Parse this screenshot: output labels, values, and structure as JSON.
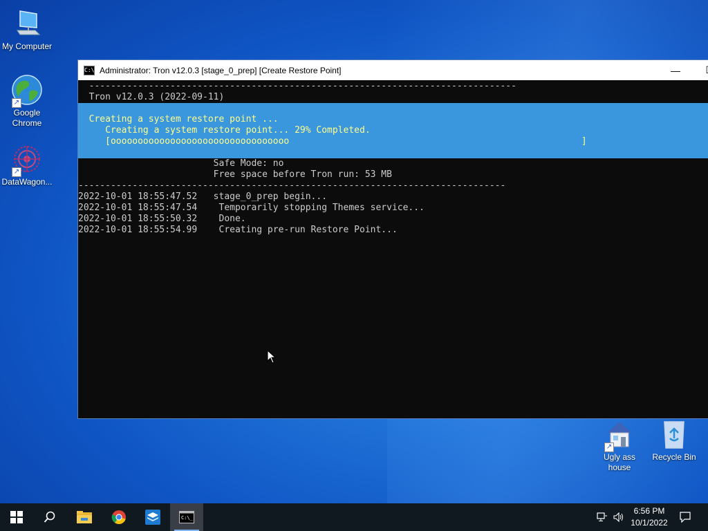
{
  "desktop": {
    "icons": [
      {
        "label": "My Computer",
        "icon": "computer-icon"
      },
      {
        "label": "Google Chrome",
        "icon": "chrome-globe-icon"
      },
      {
        "label": "DataWagon...",
        "icon": "datawagon-icon"
      },
      {
        "label": "Ugly ass house",
        "icon": "house-icon"
      },
      {
        "label": "Recycle Bin",
        "icon": "recycle-bin-icon"
      }
    ]
  },
  "window": {
    "title": "Administrator:  Tron v12.0.3 [stage_0_prep] [Create Restore Point]",
    "minimize_glyph": "—",
    "maximize_glyph": "☐"
  },
  "console": {
    "top_lines": [
      "  -------------------------------------------------------------------------------",
      "  Tron v12.0.3 (2022-09-11)"
    ],
    "progress_lines": [
      "  Creating a system restore point ...",
      "     Creating a system restore point... 29% Completed.",
      "     [ooooooooooooooooooooooooooooooooo                                                      ]"
    ],
    "progress_percent": 29,
    "bottom_lines": [
      "                         Safe Mode: no",
      "                         Free space before Tron run: 53 MB",
      "-------------------------------------------------------------------------------",
      "2022-10-01 18:55:47.52   stage_0_prep begin...",
      "2022-10-01 18:55:47.54    Temporarily stopping Themes service...",
      "2022-10-01 18:55:50.32    Done.",
      "2022-10-01 18:55:54.99    Creating pre-run Restore Point..."
    ]
  },
  "taskbar": {
    "time": "6:56 PM",
    "date": "10/1/2022",
    "items": [
      "start-icon",
      "search-icon",
      "file-explorer-icon",
      "chrome-icon",
      "datawagon-taskbar-icon",
      "cmd-icon"
    ]
  },
  "colors": {
    "progress_bg": "#3a96dd",
    "progress_text": "#ffff8c",
    "console_text": "#cccccc"
  }
}
